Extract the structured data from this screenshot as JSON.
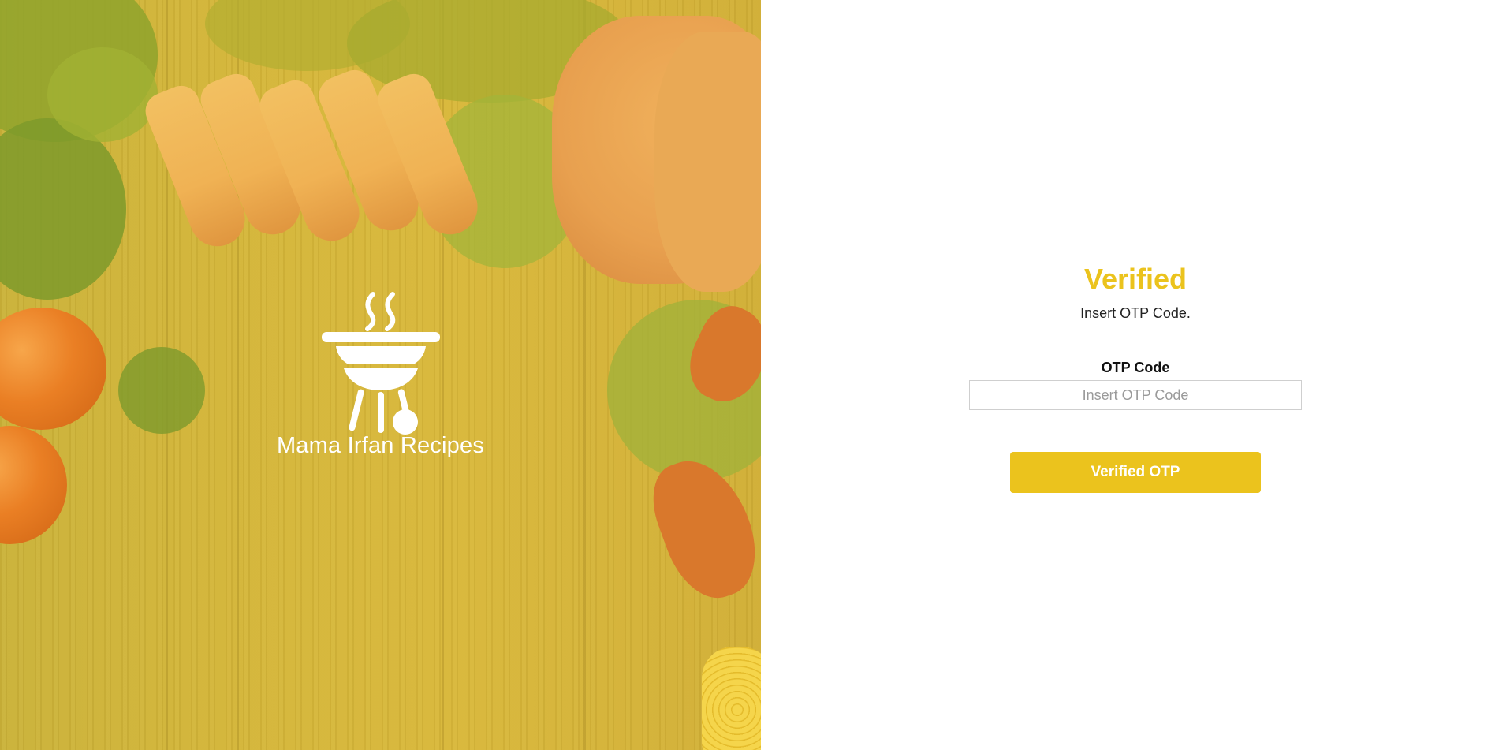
{
  "brand": {
    "name": "Mama Irfan Recipes",
    "logo_icon": "grill-icon"
  },
  "form": {
    "title": "Verified",
    "subtitle": "Insert OTP Code.",
    "otp_label": "OTP Code",
    "otp_placeholder": "Insert OTP Code",
    "otp_value": "",
    "submit_label": "Verified OTP"
  },
  "colors": {
    "accent": "#ebc31d",
    "hero_overlay": "#d6b53a",
    "text_dark": "#111111",
    "placeholder": "#9a9a9a"
  }
}
